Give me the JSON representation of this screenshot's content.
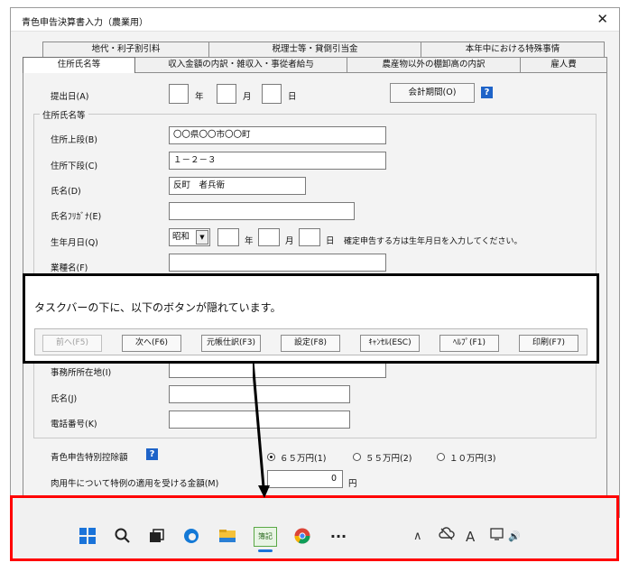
{
  "window": {
    "title": "青色申告決算書入力（農業用）",
    "close_glyph": "✕"
  },
  "tabs": {
    "row1": [
      "地代・利子割引料",
      "税理士等・貸倒引当金",
      "本年中における特殊事情"
    ],
    "row2": [
      "住所氏名等",
      "収入金額の内訳・雑収入・事從者給与",
      "農産物以外の棚卸高の内訳",
      "雇人費"
    ]
  },
  "submission": {
    "label": "提出日(A)",
    "year_unit": "年",
    "month_unit": "月",
    "day_unit": "日",
    "accounting_period_button": "会計期間(O)",
    "help_glyph": "?"
  },
  "address_group": {
    "title": "住所氏名等",
    "address_upper_label": "住所上段(B)",
    "address_upper_value": "〇〇県〇〇市〇〇町",
    "address_lower_label": "住所下段(C)",
    "address_lower_value": "１－２－３",
    "name_label": "氏名(D)",
    "name_value": "反町　者兵衛",
    "furigana_label": "氏名ﾌﾘｶﾞﾅ(E)",
    "furigana_value": "",
    "birthdate_label": "生年月日(Q)",
    "era_value": "昭和",
    "era_arrow": "▼",
    "birth_year_unit": "年",
    "birth_month_unit": "月",
    "birth_day_unit": "日",
    "birth_note": "確定申告する方は生年月日を入力してください。",
    "business_label": "業種名(F)",
    "office_address_label": "事務所所在地(I)",
    "office_name_label": "氏名(J)",
    "phone_label": "電話番号(K)"
  },
  "blue_deduction": {
    "label": "青色申告特別控除額",
    "help_glyph": "?",
    "options": [
      "６５万円(1)",
      "５５万円(2)",
      "１０万円(3)"
    ],
    "selected_index": 0
  },
  "beef": {
    "label": "肉用牛について特例の適用を受ける金額(M)",
    "value": "0",
    "unit": "円"
  },
  "callout": {
    "text": "タスクバーの下に、以下のボタンが隠れています。",
    "buttons": [
      "前へ(F5)",
      "次へ(F6)",
      "元帳仕訳(F3)",
      "設定(F8)",
      "ｷｬﾝｾﾙ(ESC)",
      "ﾍﾙﾌﾟ(F1)",
      "印刷(F7)"
    ]
  },
  "taskbar": {
    "app_label": "簿記",
    "more_glyph": "···",
    "chevron_glyph": "∧",
    "font_glyph": "A",
    "speaker_glyph": "🔊"
  },
  "colors": {
    "highlight_frame": "#ff0000",
    "help_icon": "#1e63c8"
  }
}
